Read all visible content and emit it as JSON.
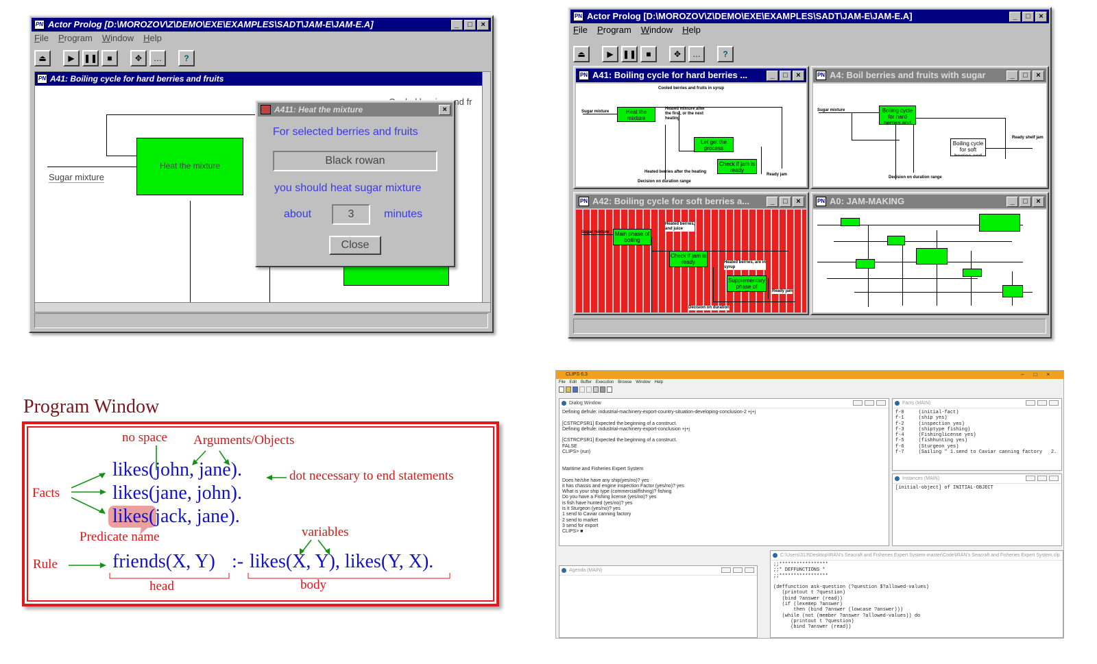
{
  "win1": {
    "title": "Actor Prolog [D:\\MOROZOV\\Z\\DEMO\\EXE\\EXAMPLES\\SADT\\JAM-E\\JAM-E.A]",
    "menu": [
      "File",
      "Program",
      "Window",
      "Help"
    ],
    "child_title": "A41: Boiling cycle for hard berries and fruits",
    "heat_box": "Heat the mixture",
    "sugar_label": "Sugar mixture",
    "cooled_label": "Cooled berries and fr",
    "dialog": {
      "title": "A411: Heat the mixture",
      "line1": "For selected berries and fruits",
      "field_value": "Black rowan",
      "line2": "you should heat sugar mixture",
      "about": "about",
      "minutes_value": "3",
      "minutes": "minutes",
      "close": "Close"
    }
  },
  "win2": {
    "title": "Actor Prolog [D:\\MOROZOV\\Z\\DEMO\\EXE\\EXAMPLES\\SADT\\JAM-E\\JAM-E.A]",
    "menu": [
      "File",
      "Program",
      "Window",
      "Help"
    ],
    "panes": [
      {
        "title": "A41: Boiling cycle for hard berries ..."
      },
      {
        "title": "A4: Boil berries and fruits with sugar"
      },
      {
        "title": "A42: Boiling cycle for soft berries a..."
      },
      {
        "title": "A0: JAM-MAKING"
      }
    ]
  },
  "program_window": {
    "heading": "Program Window",
    "lines": [
      "likes(john, jane).",
      "likes(jane, john).",
      "likes(jack, jane)."
    ],
    "rule_head": "friends(X, Y)",
    "rule_op": ":-",
    "rule_body": "likes(X, Y), likes(Y, X).",
    "notes": {
      "no_space": "no space",
      "args": "Arguments/Objects",
      "dot": "dot necessary to end statements",
      "facts": "Facts",
      "predicate": "Predicate name",
      "variables": "variables",
      "rule": "Rule",
      "head": "head",
      "body": "body"
    }
  },
  "clips": {
    "title": "CLIPS 6.3",
    "menu": [
      "File",
      "Edit",
      "Buffer",
      "Execution",
      "Browse",
      "Window",
      "Help"
    ],
    "dialog_title": "Dialog Window",
    "dialog_lines": [
      "Defining defrule: industrial-machinery-export-country-situation-developing-conclusion-2 +j+j",
      "",
      "[CSTRCPSR1] Expected the beginning of a construct.",
      "Defining defrule: industrial-machinery-export-conclusion +j+j",
      "",
      "[CSTRCPSR1] Expected the beginning of a construct.",
      "FALSE",
      "CLIPS> (run)",
      "",
      "",
      "Maritime and Fisheries Expert System",
      "",
      "Does he/she have any ship(yes/no)? yes",
      "it has chassis and engine inspection Factor (yes/no)? yes",
      "What is your ship type (commercial/fishing)? fishing",
      "Do you have a Fishing license (yes/no)? yes",
      "is fish have hunted (yes/no)? yes",
      "is it Sturgeon (yes/no)? yes",
      "1 send to Caviar canning factory",
      "2 send to market",
      "3 send for export",
      "CLIPS> ■"
    ],
    "facts_title": "Facts (MAIN)",
    "facts": [
      "f-0     (initial-fact)",
      "f-1     (ship yes)",
      "f-2     (inspection yes)",
      "f-3     (shiptype fishing)",
      "f-4     (Fishinglicense yes)",
      "f-5     (fishhunting yes)",
      "f-6     (Sturgeon yes)",
      "f-7     (Sailing \" 1.send to Caviar canning factory   2."
    ],
    "instances_title": "Instances (MAIN)",
    "instances": [
      "[initial-object] of INITIAL-OBJECT"
    ],
    "agenda_title": "Agenda (MAIN)",
    "file_title": "C:\\Users\\313\\Desktop\\IRAN's Seacraft and Fisheries Expert System-master\\Code\\IRAN's Seacraft and Fisheries Expert System.clp",
    "code": [
      ";;*****************",
      ";;* DEFFUNCTIONS *",
      ";;*****************",
      "",
      "(deffunction ask-question (?question $?allowed-values)",
      "   (printout t ?question)",
      "   (bind ?answer (read))",
      "   (if (lexemep ?answer)",
      "       then (bind ?answer (lowcase ?answer)))",
      "   (while (not (member ?answer ?allowed-values)) do",
      "      (printout t ?question)",
      "      (bind ?answer (read))"
    ]
  }
}
